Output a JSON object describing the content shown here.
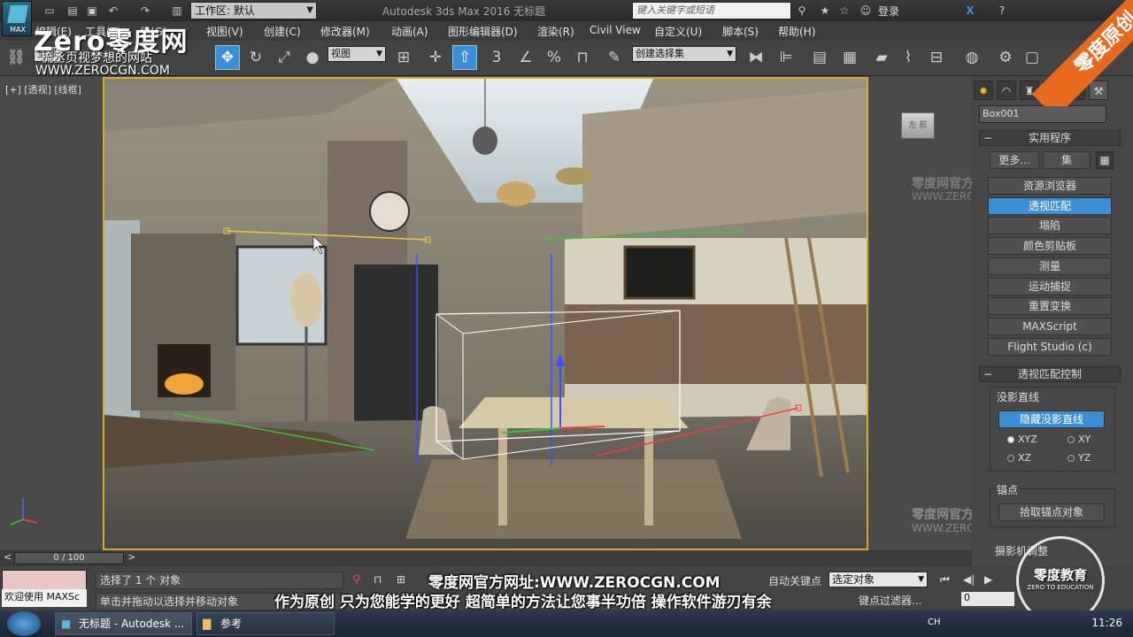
{
  "titlebar": {
    "workspace_label": "工作区: 默认",
    "window_title": "Autodesk 3ds Max 2016    无标题",
    "search_placeholder": "键入关键字或短语",
    "login_label": "登录",
    "logo_text": "MAX"
  },
  "menu": [
    "编辑(E)",
    "工具(T)",
    "组(G)",
    "视图(V)",
    "创建(C)",
    "修改器(M)",
    "动画(A)",
    "图形编辑器(D)",
    "渲染(R)",
    "Civil View",
    "自定义(U)",
    "脚本(S)",
    "帮助(H)"
  ],
  "toolbar": {
    "filter_label": "全部",
    "ref_coord": "视图",
    "selection_set": "创建选择集"
  },
  "viewport": {
    "label": "[+] [透视] [线框]",
    "viewcube_text": "左 前",
    "wm_name": "零度网官方网站",
    "wm_url": "WWW.ZEROCGN.COM"
  },
  "panel": {
    "object_name": "Box001",
    "rollout_utilities": "实用程序",
    "more_button": "更多...",
    "sets_button": "集",
    "buttons": [
      "资源浏览器",
      "透视匹配",
      "塌陷",
      "颜色剪贴板",
      "测量",
      "运动捕捉",
      "重置变换",
      "MAXScript",
      "Flight Studio (c)"
    ],
    "rollout_persp": "透视匹配控制",
    "group_vanishing": "没影直线",
    "hide_lines_button": "隐藏没影直线",
    "radios": [
      "XYZ",
      "XY",
      "XZ",
      "YZ"
    ],
    "group_anchor": "锚点",
    "pick_anchor_button": "拾取锚点对象",
    "group_camera": "摄影机调整"
  },
  "timeline": {
    "frame_label": "0 / 100"
  },
  "status": {
    "welcome": "欢迎使用 MAXSc",
    "selected_text": "选择了 1 个 对象",
    "prompt_text": "单击并拖动以选择并移动对象",
    "autokey_label": "自动关键点",
    "set_key_value": "选定对象",
    "key_filter_label": "键点过滤器...",
    "frame_value": "0"
  },
  "taskbar": {
    "task1": "无标题 - Autodesk ...",
    "task2": "参考",
    "lang": "CH",
    "time": "11:26"
  },
  "watermark": {
    "logo": "Zero零度网",
    "slogan": "梳丞页视梦想的网站",
    "url": "WWW.ZEROCGN.COM",
    "corner": "零度原创",
    "subtitle1": "零度网官方网址:WWW.ZEROCGN.COM",
    "subtitle2": "作为原创 只为您能学的更好 超简单的方法让您事半功倍 操作软件游刃有余",
    "badge": "零度教育",
    "badge_sub": "ZERO TO EDUCATION"
  },
  "colors": {
    "accent_blue": "#3a8fd6",
    "viewport_border": "#d4aa2e",
    "ribbon_orange": "#e86a1f"
  }
}
